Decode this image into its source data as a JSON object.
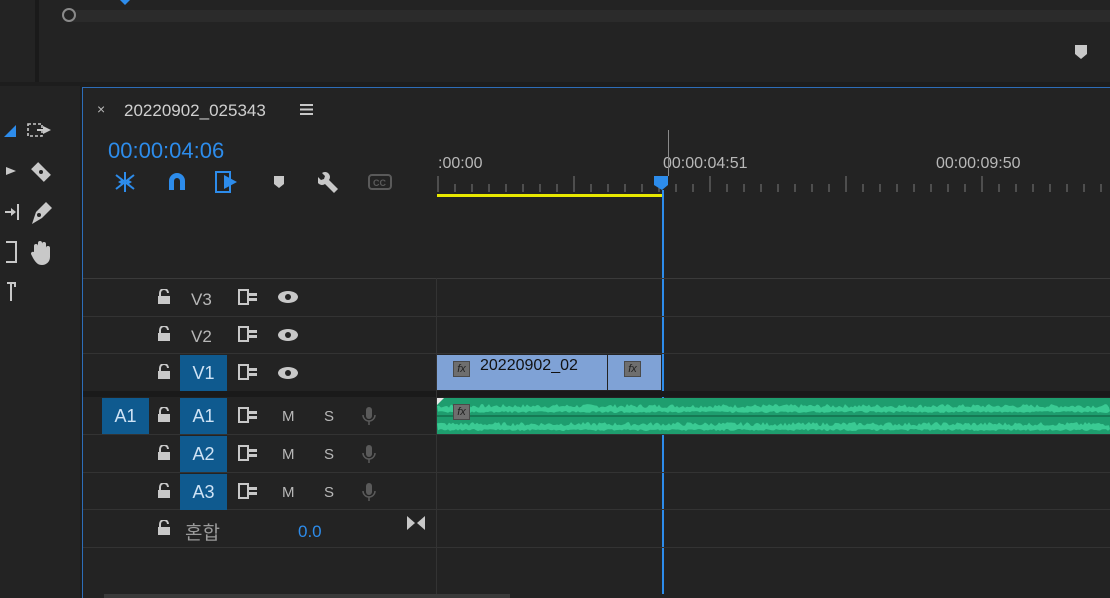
{
  "sequence": {
    "name": "20220902_025343",
    "timecode": "00:00:04:06"
  },
  "ruler": {
    "labels": [
      ":00:00",
      "00:00:04:51",
      "00:00:09:50"
    ]
  },
  "video_tracks": [
    {
      "label": "V3",
      "targeted": false
    },
    {
      "label": "V2",
      "targeted": false
    },
    {
      "label": "V1",
      "targeted": true
    }
  ],
  "audio_tracks": [
    {
      "label": "A1",
      "source": "A1",
      "mute": "M",
      "solo": "S"
    },
    {
      "label": "A2",
      "mute": "M",
      "solo": "S"
    },
    {
      "label": "A3",
      "mute": "M",
      "solo": "S"
    }
  ],
  "mix": {
    "label": "혼합",
    "value": "0.0"
  },
  "clip": {
    "name": "20220902_02",
    "fx": "fx"
  },
  "colors": {
    "accent": "#2d8ceb",
    "clip_video": "#7fa2d6",
    "clip_audio": "#1e9d6e",
    "work_area": "#e8e800",
    "track_target": "#0f5a8f"
  },
  "icons": {
    "close": "close-icon",
    "menu": "hamburger-menu-icon"
  }
}
